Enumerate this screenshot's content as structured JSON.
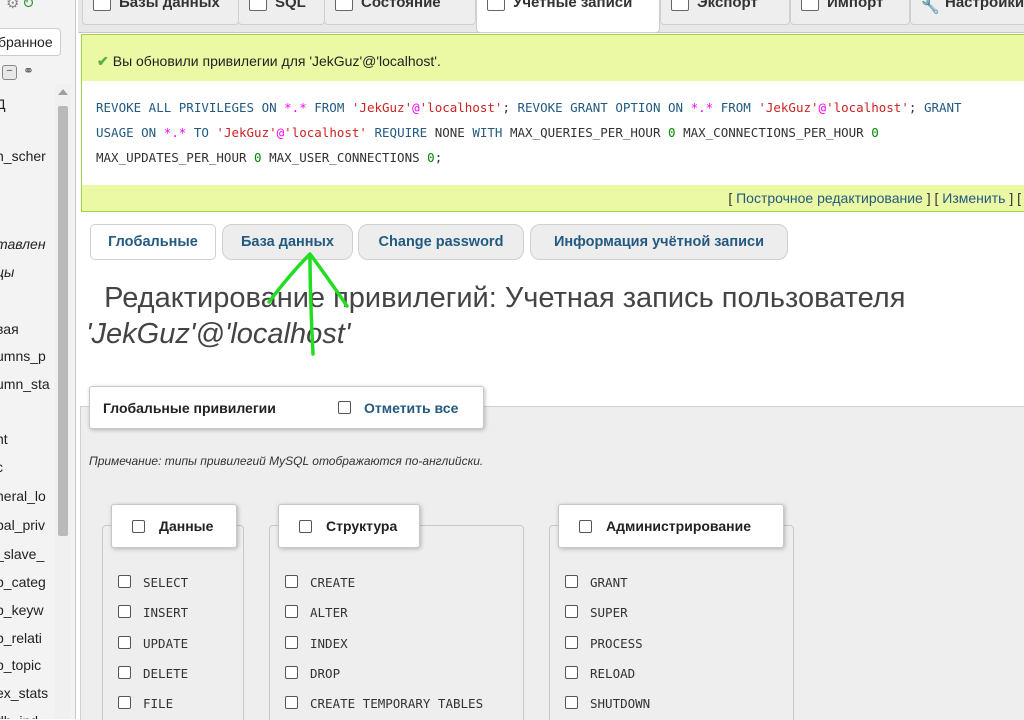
{
  "nav": {
    "favorites_tab": "бранное",
    "items": [
      {
        "label": "Д",
        "italic": false
      },
      {
        "label": "n_scher",
        "italic": false
      },
      {
        "label": "тавлен",
        "italic": true
      },
      {
        "label": "цы",
        "italic": true
      },
      {
        "label": "вая",
        "italic": false
      },
      {
        "label": "umns_p",
        "italic": false
      },
      {
        "label": "umn_sta",
        "italic": false
      },
      {
        "label": "nt",
        "italic": false
      },
      {
        "label": "c",
        "italic": false
      },
      {
        "label": "neral_lo",
        "italic": false
      },
      {
        "label": "bal_priv",
        "italic": false
      },
      {
        "label": "_slave_",
        "italic": false
      },
      {
        "label": "p_categ",
        "italic": false
      },
      {
        "label": "p_keyw",
        "italic": false
      },
      {
        "label": "p_relati",
        "italic": false
      },
      {
        "label": "p_topic",
        "italic": false
      },
      {
        "label": "ex_stats",
        "italic": false
      },
      {
        "label": "db_ind",
        "italic": false
      }
    ]
  },
  "tabs": [
    {
      "label": "Базы данных",
      "active": false
    },
    {
      "label": "SQL",
      "active": false
    },
    {
      "label": "Состояние",
      "active": false
    },
    {
      "label": "Учетные записи",
      "active": true
    },
    {
      "label": "Экспорт",
      "active": false
    },
    {
      "label": "Импорт",
      "active": false
    },
    {
      "label": "Настройки",
      "active": false
    }
  ],
  "success": {
    "message": "Вы обновили привилегии для 'JekGuz'@'localhost'.",
    "edit_inline": "Построчное редактирование",
    "edit": "Изменить"
  },
  "subtabs": [
    {
      "label": "Глобальные",
      "active": true
    },
    {
      "label": "База данных",
      "active": false
    },
    {
      "label": "Change password",
      "active": false
    },
    {
      "label": "Информация учётной записи",
      "active": false
    }
  ],
  "page_title": {
    "text": "Редактирование привилегий: Учетная запись пользователя",
    "account": "'JekGuz'@'localhost'"
  },
  "global_privs": {
    "legend": "Глобальные привилегии",
    "check_all": "Отметить все",
    "note": "Примечание: типы привилегий MySQL отображаются по-английски."
  },
  "groups": [
    {
      "title": "Данные",
      "privileges": [
        "SELECT",
        "INSERT",
        "UPDATE",
        "DELETE",
        "FILE"
      ]
    },
    {
      "title": "Структура",
      "privileges": [
        "CREATE",
        "ALTER",
        "INDEX",
        "DROP",
        "CREATE TEMPORARY TABLES"
      ]
    },
    {
      "title": "Администрирование",
      "privileges": [
        "GRANT",
        "SUPER",
        "PROCESS",
        "RELOAD",
        "SHUTDOWN"
      ]
    }
  ],
  "colors": {
    "link": "#235a81",
    "success_bg": "#ebf8a4",
    "annotation": "#22dd22"
  }
}
